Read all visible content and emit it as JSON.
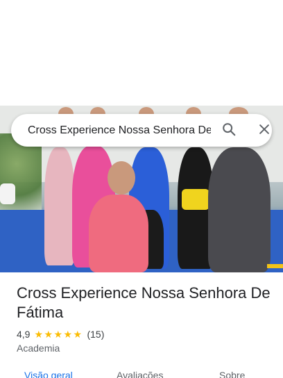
{
  "search": {
    "query": "Cross Experience Nossa Senhora De Fátima"
  },
  "place": {
    "name": "Cross Experience Nossa Senhora De Fátima",
    "rating": "4,9",
    "review_count": "(15)",
    "stars": 5,
    "category": "Academia"
  },
  "tabs": [
    {
      "label": "Visão geral",
      "active": true
    },
    {
      "label": "Avaliações",
      "active": false
    },
    {
      "label": "Sobre",
      "active": false
    }
  ],
  "colors": {
    "accent": "#1a73e8",
    "star": "#fbbc04"
  },
  "icons": {
    "search": "search-icon",
    "close": "close-icon"
  }
}
